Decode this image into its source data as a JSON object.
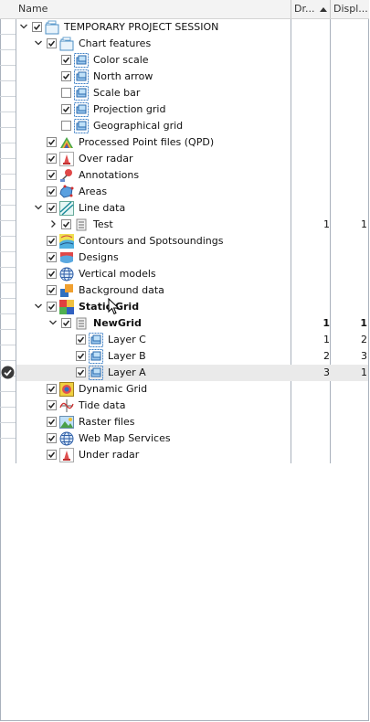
{
  "header": {
    "name_col": "Name",
    "draw_col": "Dr...",
    "display_col": "Displ..."
  },
  "tree": [
    {
      "id": "root",
      "label": "TEMPORARY PROJECT SESSION",
      "level": 0,
      "expander": "open",
      "checked": true,
      "icon": "folder-icon",
      "draw": "",
      "display": "",
      "bold": false
    },
    {
      "id": "chart-features",
      "label": "Chart features",
      "level": 1,
      "expander": "open",
      "checked": true,
      "icon": "folder-icon",
      "draw": "",
      "display": "",
      "bold": false
    },
    {
      "id": "color-scale",
      "label": "Color scale",
      "level": 2,
      "expander": "none",
      "checked": true,
      "icon": "layer-icon",
      "draw": "",
      "display": "",
      "bold": false
    },
    {
      "id": "north-arrow",
      "label": "North arrow",
      "level": 2,
      "expander": "none",
      "checked": true,
      "icon": "layer-icon",
      "draw": "",
      "display": "",
      "bold": false
    },
    {
      "id": "scale-bar",
      "label": "Scale bar",
      "level": 2,
      "expander": "none",
      "checked": false,
      "icon": "layer-icon",
      "draw": "",
      "display": "",
      "bold": false
    },
    {
      "id": "projection-grid",
      "label": "Projection grid",
      "level": 2,
      "expander": "none",
      "checked": true,
      "icon": "layer-icon",
      "draw": "",
      "display": "",
      "bold": false
    },
    {
      "id": "geographical-grid",
      "label": "Geographical grid",
      "level": 2,
      "expander": "none",
      "checked": false,
      "icon": "layer-icon",
      "draw": "",
      "display": "",
      "bold": false
    },
    {
      "id": "qpd",
      "label": "Processed Point files (QPD)",
      "level": 1,
      "expander": "none",
      "checked": true,
      "icon": "qpd-icon",
      "draw": "",
      "display": "",
      "bold": false
    },
    {
      "id": "over-radar",
      "label": "Over radar",
      "level": 1,
      "expander": "none",
      "checked": true,
      "icon": "radar-icon",
      "draw": "",
      "display": "",
      "bold": false
    },
    {
      "id": "annotations",
      "label": "Annotations",
      "level": 1,
      "expander": "none",
      "checked": true,
      "icon": "annotation-icon",
      "draw": "",
      "display": "",
      "bold": false
    },
    {
      "id": "areas",
      "label": "Areas",
      "level": 1,
      "expander": "none",
      "checked": true,
      "icon": "areas-icon",
      "draw": "",
      "display": "",
      "bold": false
    },
    {
      "id": "line-data",
      "label": "Line data",
      "level": 1,
      "expander": "open",
      "checked": true,
      "icon": "line-data-icon",
      "draw": "",
      "display": "",
      "bold": false
    },
    {
      "id": "test",
      "label": "Test",
      "level": 2,
      "expander": "closed",
      "checked": true,
      "icon": "list-icon",
      "draw": "1",
      "display": "1",
      "bold": false
    },
    {
      "id": "contours",
      "label": "Contours and Spotsoundings",
      "level": 1,
      "expander": "none",
      "checked": true,
      "icon": "contours-icon",
      "draw": "",
      "display": "",
      "bold": false
    },
    {
      "id": "designs",
      "label": "Designs",
      "level": 1,
      "expander": "none",
      "checked": true,
      "icon": "designs-icon",
      "draw": "",
      "display": "",
      "bold": false
    },
    {
      "id": "vertical-models",
      "label": "Vertical models",
      "level": 1,
      "expander": "none",
      "checked": true,
      "icon": "globe-icon",
      "draw": "",
      "display": "",
      "bold": false
    },
    {
      "id": "background-data",
      "label": "Background data",
      "level": 1,
      "expander": "none",
      "checked": true,
      "icon": "background-icon",
      "draw": "",
      "display": "",
      "bold": false
    },
    {
      "id": "static-grid",
      "label": "Static Grid",
      "level": 1,
      "expander": "open",
      "checked": true,
      "icon": "grid-icon",
      "draw": "",
      "display": "",
      "bold": true
    },
    {
      "id": "newgrid",
      "label": "NewGrid",
      "level": 2,
      "expander": "open",
      "checked": true,
      "icon": "list-icon",
      "draw": "1",
      "display": "1",
      "bold": true
    },
    {
      "id": "layer-c",
      "label": "Layer C",
      "level": 3,
      "expander": "none",
      "checked": true,
      "icon": "layer-icon",
      "draw": "1",
      "display": "2",
      "bold": false
    },
    {
      "id": "layer-b",
      "label": "Layer B",
      "level": 3,
      "expander": "none",
      "checked": true,
      "icon": "layer-icon",
      "draw": "2",
      "display": "3",
      "bold": false
    },
    {
      "id": "layer-a",
      "label": "Layer A",
      "level": 3,
      "expander": "none",
      "checked": true,
      "icon": "layer-icon",
      "draw": "3",
      "display": "1",
      "bold": false,
      "selected": true
    },
    {
      "id": "dynamic-grid",
      "label": "Dynamic Grid",
      "level": 1,
      "expander": "none",
      "checked": true,
      "icon": "dynamic-grid-icon",
      "draw": "",
      "display": "",
      "bold": false
    },
    {
      "id": "tide-data",
      "label": "Tide data",
      "level": 1,
      "expander": "none",
      "checked": true,
      "icon": "tide-icon",
      "draw": "",
      "display": "",
      "bold": false
    },
    {
      "id": "raster-files",
      "label": "Raster files",
      "level": 1,
      "expander": "none",
      "checked": true,
      "icon": "raster-icon",
      "draw": "",
      "display": "",
      "bold": false
    },
    {
      "id": "wms",
      "label": "Web Map Services",
      "level": 1,
      "expander": "none",
      "checked": true,
      "icon": "globe-icon",
      "draw": "",
      "display": "",
      "bold": false
    },
    {
      "id": "under-radar",
      "label": "Under radar",
      "level": 1,
      "expander": "none",
      "checked": true,
      "icon": "radar-icon",
      "draw": "",
      "display": "",
      "bold": false
    }
  ]
}
